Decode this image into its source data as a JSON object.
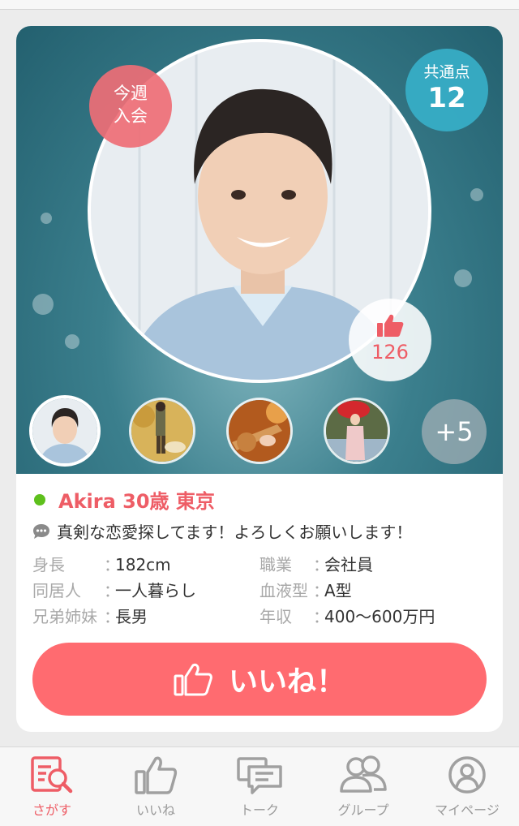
{
  "profile": {
    "new_badge_line1": "今週",
    "new_badge_line2": "入会",
    "common_label": "共通点",
    "common_count": "12",
    "like_count": "126",
    "more_photos": "+5",
    "name": "Akira 30歳 東京",
    "online_color": "#5ec01c",
    "message": "真剣な恋愛探してます！よろしくお願いします！"
  },
  "attributes": {
    "left": [
      {
        "key": "身長",
        "value": "182cm"
      },
      {
        "key": "同居人",
        "value": "一人暮らし"
      },
      {
        "key": "兄弟姉妹",
        "value": "長男"
      }
    ],
    "right": [
      {
        "key": "職業",
        "value": "会社員"
      },
      {
        "key": "血液型",
        "value": "A型"
      },
      {
        "key": "年収",
        "value": "400〜600万円"
      }
    ]
  },
  "separator": "：",
  "like_button": "いいね！",
  "tabs": [
    {
      "label": "さがす",
      "icon": "search-icon",
      "active": true
    },
    {
      "label": "いいね",
      "icon": "thumbs-up-icon",
      "active": false
    },
    {
      "label": "トーク",
      "icon": "chat-icon",
      "active": false
    },
    {
      "label": "グループ",
      "icon": "group-icon",
      "active": false
    },
    {
      "label": "マイページ",
      "icon": "user-icon",
      "active": false
    }
  ],
  "colors": {
    "accent": "#ff6b70",
    "common_badge": "#37afc8",
    "inactive": "#9a9a9a"
  }
}
